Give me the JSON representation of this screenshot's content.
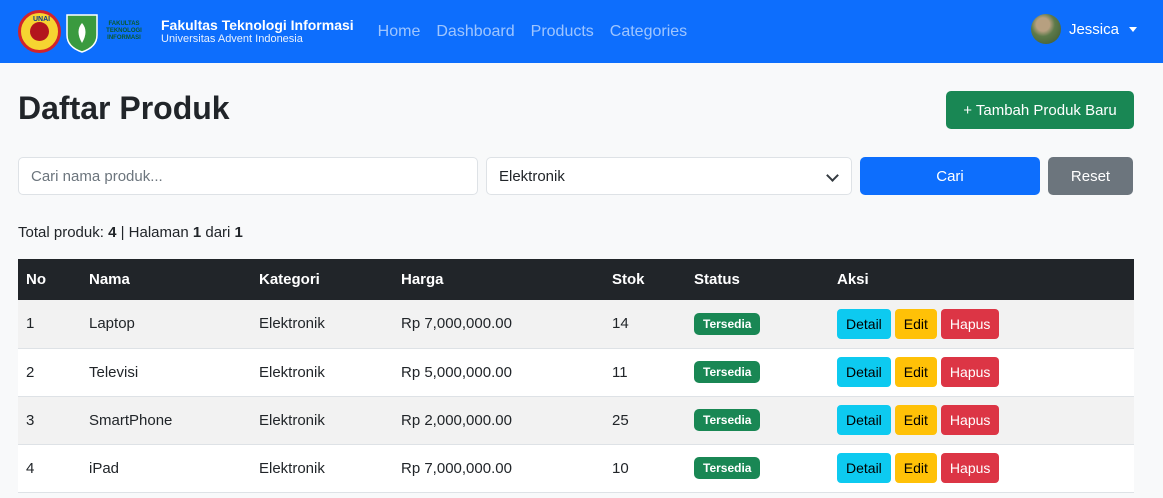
{
  "navbar": {
    "logo1_text": "UNAI",
    "logo2_lines": [
      "FAKULTAS",
      "TEKNOLOGI",
      "INFORMASI"
    ],
    "brand_title": "Fakultas Teknologi Informasi",
    "brand_subtitle": "Universitas Advent Indonesia",
    "links": [
      "Home",
      "Dashboard",
      "Products",
      "Categories"
    ],
    "user_name": "Jessica"
  },
  "page": {
    "title": "Daftar Produk",
    "add_button": "+ Tambah Produk Baru"
  },
  "filter": {
    "search_placeholder": "Cari nama produk...",
    "search_value": "",
    "category_selected": "Elektronik",
    "search_button": "Cari",
    "reset_button": "Reset"
  },
  "summary": {
    "total_label": "Total produk:",
    "total": "4",
    "page_label": "| Halaman",
    "page": "1",
    "of_label": "dari",
    "pages": "1"
  },
  "table": {
    "headers": [
      "No",
      "Nama",
      "Kategori",
      "Harga",
      "Stok",
      "Status",
      "Aksi"
    ],
    "rows": [
      {
        "no": "1",
        "nama": "Laptop",
        "kategori": "Elektronik",
        "harga": "Rp 7,000,000.00",
        "stok": "14",
        "status": "Tersedia"
      },
      {
        "no": "2",
        "nama": "Televisi",
        "kategori": "Elektronik",
        "harga": "Rp 5,000,000.00",
        "stok": "11",
        "status": "Tersedia"
      },
      {
        "no": "3",
        "nama": "SmartPhone",
        "kategori": "Elektronik",
        "harga": "Rp 2,000,000.00",
        "stok": "25",
        "status": "Tersedia"
      },
      {
        "no": "4",
        "nama": "iPad",
        "kategori": "Elektronik",
        "harga": "Rp 7,000,000.00",
        "stok": "10",
        "status": "Tersedia"
      }
    ],
    "actions": {
      "detail": "Detail",
      "edit": "Edit",
      "hapus": "Hapus"
    }
  },
  "colors": {
    "primary": "#0d6efd",
    "success": "#198754",
    "secondary": "#6c757d",
    "info": "#0dcaf0",
    "warning": "#ffc107",
    "danger": "#dc3545",
    "dark": "#212529"
  }
}
